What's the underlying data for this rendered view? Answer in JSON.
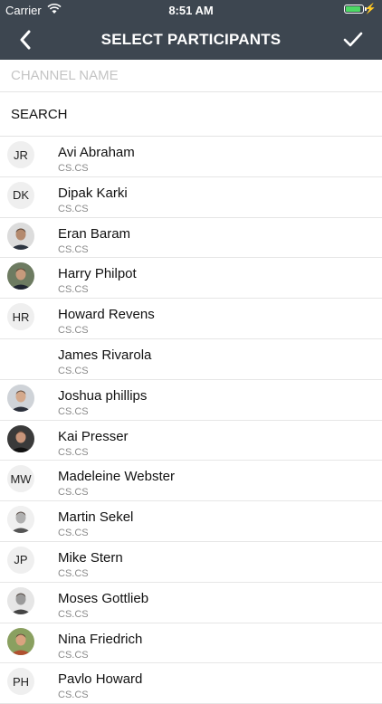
{
  "status": {
    "carrier": "Carrier",
    "time": "8:51 AM",
    "battery_level": 0.9
  },
  "nav": {
    "title": "SELECT PARTICIPANTS",
    "back_icon": "chevron-left-icon",
    "done_icon": "checkmark-icon"
  },
  "channel_name": {
    "placeholder": "CHANNEL NAME",
    "value": ""
  },
  "search": {
    "placeholder": "SEARCH"
  },
  "participants": [
    {
      "name": "Avi Abraham",
      "org": "CS.CS",
      "initials": "JR",
      "avatar": "initials"
    },
    {
      "name": "Dipak Karki",
      "org": "CS.CS",
      "initials": "DK",
      "avatar": "initials"
    },
    {
      "name": "Eran Baram",
      "org": "CS.CS",
      "initials": "",
      "avatar": "photo",
      "tone": "#b48a6e",
      "bg": "#dcdcdc",
      "shirt": "#2c3440"
    },
    {
      "name": "Harry Philpot",
      "org": "CS.CS",
      "initials": "",
      "avatar": "photo",
      "tone": "#c79a7c",
      "bg": "#6d7b61",
      "shirt": "#1e2430"
    },
    {
      "name": "Howard Revens",
      "org": "CS.CS",
      "initials": "HR",
      "avatar": "initials"
    },
    {
      "name": "James Rivarola",
      "org": "CS.CS",
      "initials": "",
      "avatar": "blank"
    },
    {
      "name": "Joshua phillips",
      "org": "CS.CS",
      "initials": "",
      "avatar": "photo",
      "tone": "#d4a98c",
      "bg": "#cfd3d8",
      "shirt": "#2a2f3a"
    },
    {
      "name": "Kai Presser",
      "org": "CS.CS",
      "initials": "",
      "avatar": "photo",
      "tone": "#c8957a",
      "bg": "#3a3a3a",
      "shirt": "#111111"
    },
    {
      "name": "Madeleine Webster",
      "org": "CS.CS",
      "initials": "MW",
      "avatar": "initials"
    },
    {
      "name": "Martin Sekel",
      "org": "CS.CS",
      "initials": "",
      "avatar": "photo",
      "tone": "#b0b0b0",
      "bg": "#f0f0f0",
      "shirt": "#555555"
    },
    {
      "name": "Mike Stern",
      "org": "CS.CS",
      "initials": "JP",
      "avatar": "initials"
    },
    {
      "name": "Moses Gottlieb",
      "org": "CS.CS",
      "initials": "",
      "avatar": "photo",
      "tone": "#9a9a9a",
      "bg": "#e6e6e6",
      "shirt": "#444444"
    },
    {
      "name": "Nina Friedrich",
      "org": "CS.CS",
      "initials": "",
      "avatar": "photo",
      "tone": "#d9a37f",
      "bg": "#8aa060",
      "shirt": "#b05030"
    },
    {
      "name": "Pavlo Howard",
      "org": "CS.CS",
      "initials": "PH",
      "avatar": "initials"
    }
  ]
}
